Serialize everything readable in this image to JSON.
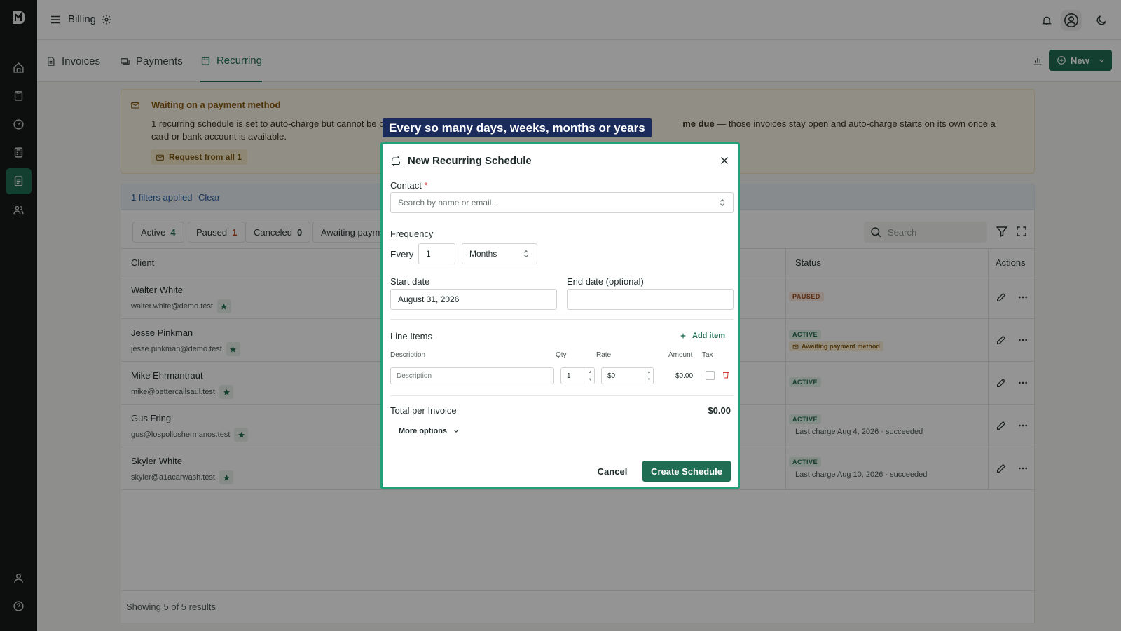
{
  "topbar": {
    "title": "Billing"
  },
  "tabs": [
    {
      "label": "Invoices"
    },
    {
      "label": "Payments"
    },
    {
      "label": "Recurring"
    }
  ],
  "new_button": {
    "label": "New"
  },
  "banner": {
    "title": "Waiting on a payment method",
    "text_a": "1 recurring schedule is set to auto-charge but cannot be charged",
    "text_bold": "me due",
    "text_b": " — those invoices stay open and auto-charge starts on its own once a card or bank account is available.",
    "button_label": "Request from all 1"
  },
  "filters": {
    "count_label": "1 filters applied",
    "clear_label": "Clear"
  },
  "status_pills": [
    {
      "label": "Active",
      "count": "4"
    },
    {
      "label": "Paused",
      "count": "1"
    },
    {
      "label": "Canceled",
      "count": "0"
    },
    {
      "label": "Awaiting paym",
      "count": ""
    }
  ],
  "search": {
    "placeholder": "Search"
  },
  "table": {
    "columns": {
      "client": "Client",
      "status": "Status",
      "actions": "Actions"
    },
    "rows": [
      {
        "name": "Walter White",
        "email": "walter.white@demo.test",
        "status": "PAUSED",
        "status_type": "paused",
        "sub_badge": "",
        "last_charge": ""
      },
      {
        "name": "Jesse Pinkman",
        "email": "jesse.pinkman@demo.test",
        "status": "ACTIVE",
        "status_type": "active",
        "sub_badge": "Awaiting payment method",
        "last_charge": ""
      },
      {
        "name": "Mike Ehrmantraut",
        "email": "mike@bettercallsaul.test",
        "status": "ACTIVE",
        "status_type": "active",
        "sub_badge": "",
        "last_charge": ""
      },
      {
        "name": "Gus Fring",
        "email": "gus@lospolloshermanos.test",
        "status": "ACTIVE",
        "status_type": "active",
        "sub_badge": "",
        "last_charge": "Last charge Aug 4, 2026 · succeeded"
      },
      {
        "name": "Skyler White",
        "email": "skyler@a1acarwash.test",
        "status": "ACTIVE",
        "status_type": "active",
        "sub_badge": "",
        "last_charge": "Last charge Aug 10, 2026 · succeeded"
      }
    ],
    "footer": "Showing 5 of 5 results"
  },
  "tooltip": {
    "text": "Every so many days, weeks, months or years"
  },
  "modal": {
    "title": "New Recurring Schedule",
    "contact_label": "Contact",
    "contact_required": "*",
    "contact_placeholder": "Search by name or email...",
    "frequency_label": "Frequency",
    "every_label": "Every",
    "every_value": "1",
    "unit_value": "Months",
    "start_label": "Start date",
    "start_value": "August 31, 2026",
    "end_label": "End date (optional)",
    "end_value": "",
    "line_items_label": "Line Items",
    "add_item_label": "Add item",
    "columns": {
      "description": "Description",
      "qty": "Qty",
      "rate": "Rate",
      "amount": "Amount",
      "tax": "Tax"
    },
    "line": {
      "description_placeholder": "Description",
      "qty": "1",
      "rate": "$0",
      "amount": "$0.00"
    },
    "total_label": "Total per Invoice",
    "total_value": "$0.00",
    "more_options_label": "More options",
    "cancel_label": "Cancel",
    "create_label": "Create Schedule"
  },
  "colors": {
    "accent": "#1f6d52",
    "modal_border": "#21a07a",
    "tooltip_bg": "#1b2b5b"
  }
}
